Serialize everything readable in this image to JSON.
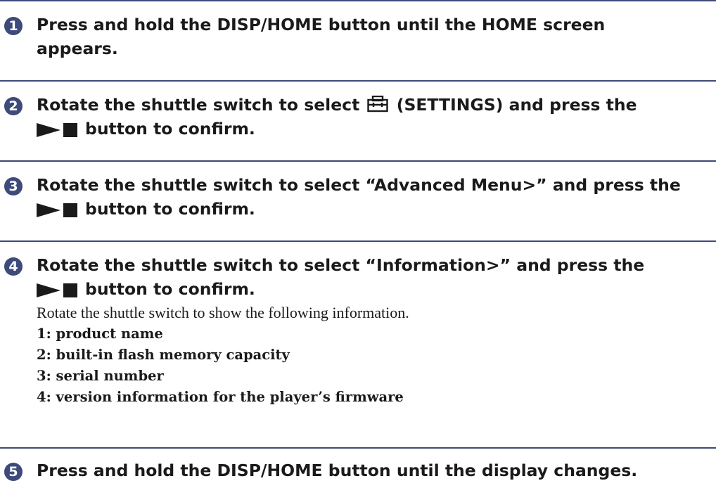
{
  "steps": [
    {
      "number": "1",
      "line1": "Press and hold the DISP/HOME button until the HOME screen",
      "line2": "appears."
    },
    {
      "number": "2",
      "line1_prefix": "Rotate the shuttle switch to select",
      "line1_suffix": "(SETTINGS) and press the",
      "settings_icon": "settings-toolbox-icon",
      "play_icon": "play-stop-icon",
      "line2": "button to confirm."
    },
    {
      "number": "3",
      "line1": "Rotate the shuttle switch to select “Advanced Menu>” and press the",
      "play_icon": "play-stop-icon",
      "line2": "button to confirm."
    },
    {
      "number": "4",
      "line1": "Rotate the shuttle switch to select “Information>” and press the",
      "play_icon": "play-stop-icon",
      "line2": "button to confirm.",
      "body": "Rotate the shuttle switch to show the following information.",
      "info": [
        "1: product name",
        "2: built-in flash memory capacity",
        "3: serial number",
        "4: version information for the player’s firmware"
      ]
    },
    {
      "number": "5",
      "line1": "Press and hold the DISP/HOME button until the display changes."
    }
  ],
  "colors": {
    "accent": "#3d4a7a",
    "text": "#1a1a1a"
  }
}
